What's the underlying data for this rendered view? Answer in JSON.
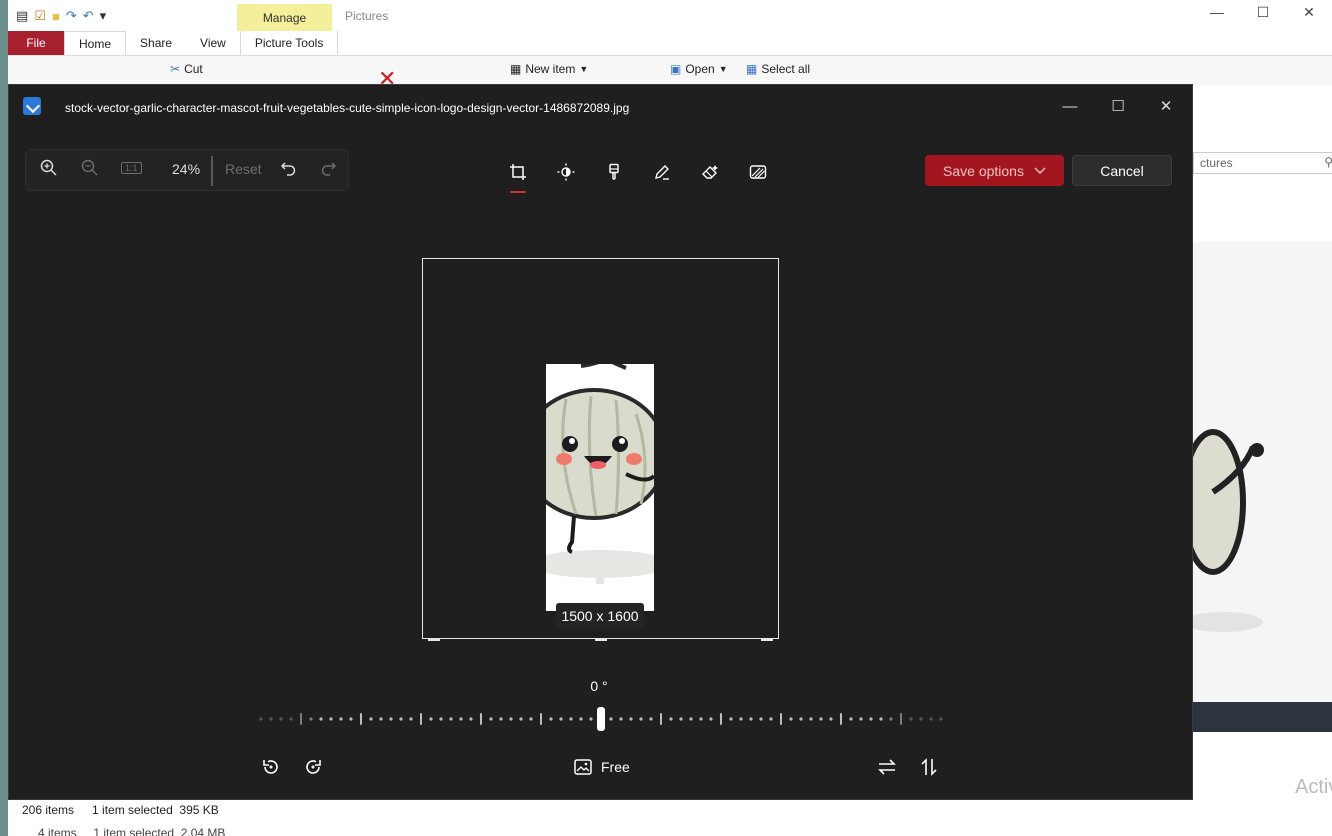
{
  "explorer": {
    "context_tab": "Manage",
    "window_title": "Pictures",
    "tabs": [
      "File",
      "Home",
      "Share",
      "View",
      "Picture Tools"
    ],
    "ribbon": {
      "cut": "Cut",
      "new_item": "New item",
      "open": "Open",
      "select_all": "Select all"
    },
    "search_placeholder": "ctures",
    "status": {
      "items": "206 items",
      "selected": "1 item selected  395 KB",
      "second_line": "4 items     1 item selected  2.04 MB"
    },
    "activate_text": "Activ"
  },
  "editor": {
    "title": "stock-vector-garlic-character-mascot-fruit-vegetables-cute-simple-icon-logo-design-vector-1486872089.jpg",
    "zoom": {
      "zoom_in_icon": "zoom-in-icon",
      "zoom_out_icon": "zoom-out-icon",
      "actual_size_icon": "actual-size-icon",
      "actual_size_text": "1:1",
      "percent": "24%",
      "reset": "Reset"
    },
    "save_options": "Save options",
    "cancel": "Cancel",
    "dimensions": "1500 x 1600",
    "angle": "0 °",
    "aspect": "Free"
  },
  "colors": {
    "accent": "#a4161f",
    "editor_bg": "#1f1f1f",
    "file_tab": "#a7202f",
    "manage_tab": "#f3ef9a"
  }
}
